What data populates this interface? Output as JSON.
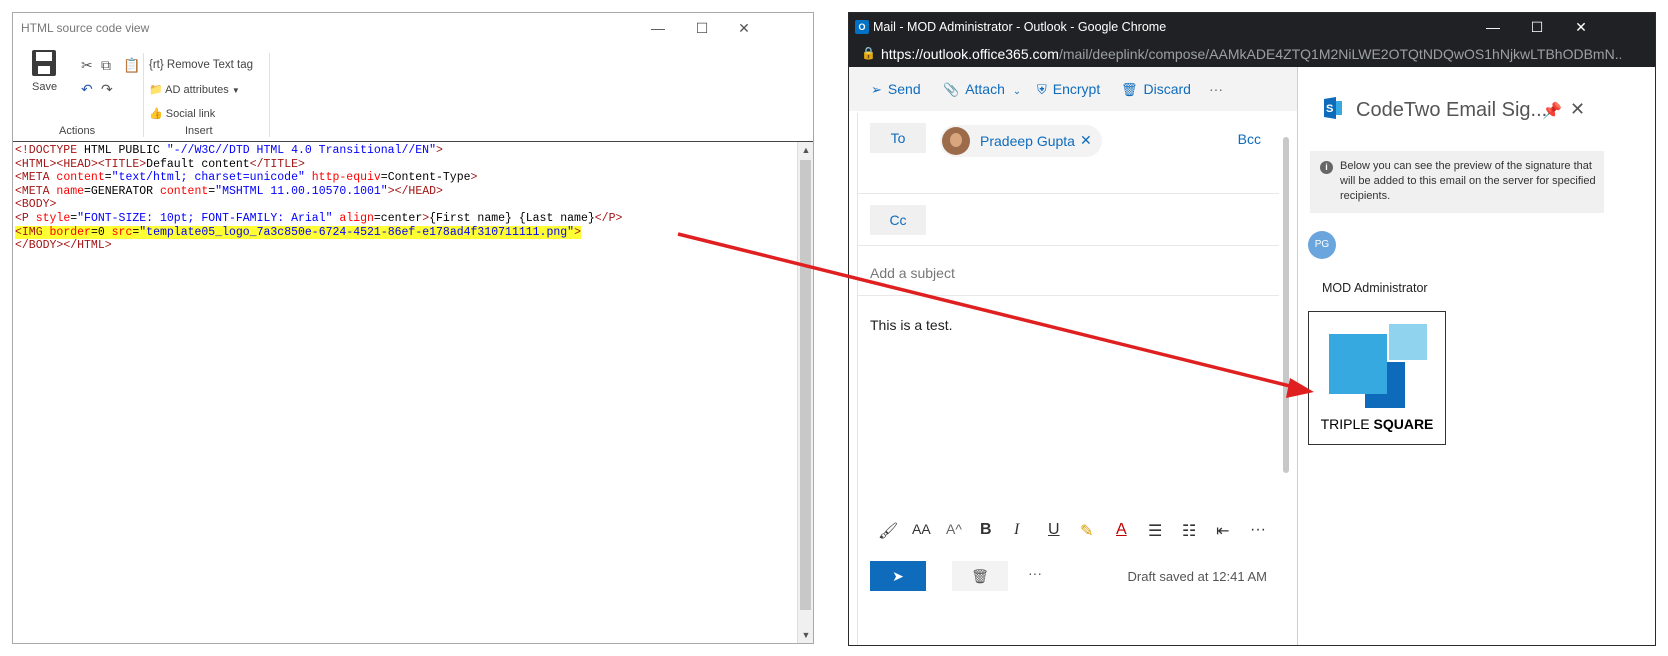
{
  "left_window": {
    "title": "HTML source code view",
    "controls": {
      "minimize": "—",
      "maximize": "☐",
      "close": "✕"
    },
    "ribbon": {
      "save_label": "Save",
      "actions_group": "Actions",
      "insert_group": "Insert",
      "remove_text_tag": "{rt} Remove Text tag",
      "ad_attributes": "AD attributes",
      "social_link": "Social link"
    },
    "code_lines": [
      "<!DOCTYPE HTML PUBLIC \"-//W3C//DTD HTML 4.0 Transitional//EN\">",
      "<HTML><HEAD><TITLE>Default content</TITLE>",
      "<META content=\"text/html; charset=unicode\" http-equiv=Content-Type>",
      "<META name=GENERATOR content=\"MSHTML 11.00.10570.1001\"></HEAD>",
      "<BODY>",
      "<P style=\"FONT-SIZE: 10pt; FONT-FAMILY: Arial\" align=center>{First name} {Last name}</P>",
      "<IMG border=0 src=\"template05_logo_7a3c850e-6724-4521-86ef-e178ad4f310711111.png\">",
      "</BODY></HTML>"
    ]
  },
  "right_window": {
    "title": "Mail - MOD Administrator - Outlook - Google Chrome",
    "url_host": "https://outlook.office365.com",
    "url_path": "/mail/deeplink/compose/AAMkADE4ZTQ1M2NiLWE2OTQtNDQwOS1hNjkwLTBhODBmN...",
    "toolbar": {
      "send": "Send",
      "attach": "Attach",
      "encrypt": "Encrypt",
      "discard": "Discard",
      "more": "···"
    },
    "compose": {
      "to_label": "To",
      "recipient_name": "Pradeep Gupta",
      "bcc_label": "Bcc",
      "cc_label": "Cc",
      "subject_placeholder": "Add a subject",
      "body": "This is a test.",
      "draft_status": "Draft saved at 12:41 AM",
      "more_dots": "···"
    },
    "addin": {
      "title": "CodeTwo Email Sig...",
      "info_text": "Below you can see the preview of the signature that will be added to this email on the server for specified recipients.",
      "avatar_initials": "PG",
      "sender_name": "MOD Administrator",
      "logo_caption_light": "TRIPLE ",
      "logo_caption_bold": "SQUARE"
    }
  },
  "colors": {
    "highlight": "#ffff33",
    "accent": "#0f6cbd",
    "arrow": "#e02020"
  }
}
